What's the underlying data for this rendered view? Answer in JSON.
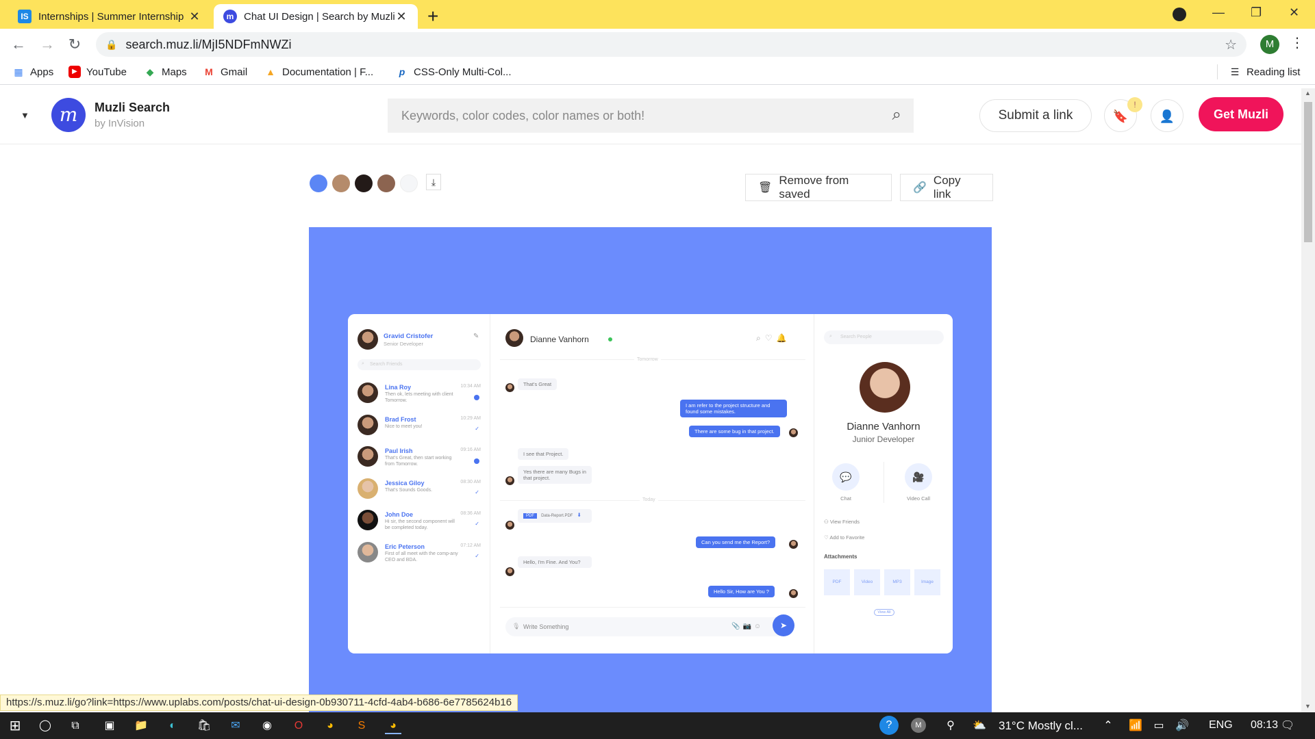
{
  "browser": {
    "tabs": [
      {
        "title": "Internships | Summer Internship",
        "favicon_text": "IS",
        "active": false
      },
      {
        "title": "Chat UI Design | Search by Muzli",
        "favicon_text": "m",
        "active": true
      }
    ],
    "url": "search.muz.li/MjI5NDFmNWZi",
    "profile_initial": "M",
    "bookmarks": [
      {
        "label": "Apps",
        "icon": "apps-grid-icon"
      },
      {
        "label": "YouTube",
        "icon": "youtube-icon"
      },
      {
        "label": "Maps",
        "icon": "maps-icon"
      },
      {
        "label": "Gmail",
        "icon": "gmail-icon"
      },
      {
        "label": "Documentation  |  F...",
        "icon": "firebase-icon"
      },
      {
        "label": "CSS-Only Multi-Col...",
        "icon": "bookmark-site-icon"
      }
    ],
    "reading_list": "Reading list"
  },
  "header": {
    "brand": "Muzli Search",
    "brand_sub": "by InVision",
    "search_placeholder": "Keywords, color codes, color names or both!",
    "submit_link": "Submit a link",
    "badge": "!",
    "get_muzli": "Get Muzli"
  },
  "palette": {
    "colors": [
      "#5b86f5",
      "#b58b6b",
      "#231a18",
      "#8c6450",
      "#f5f6f8"
    ]
  },
  "actions": {
    "remove": "Remove from saved",
    "copy": "Copy link"
  },
  "mockup": {
    "profile_name": "Gravid Cristofer",
    "profile_role": "Senior Developer",
    "search_friends": "Search Friends",
    "friends": [
      {
        "name": "Lina Roy",
        "msg": "Then ok, lets meeting with client Tomorrow.",
        "time": "10:34 AM",
        "unread": true
      },
      {
        "name": "Brad Frost",
        "msg": "Nice to meet you!",
        "time": "10:29 AM",
        "unread": false
      },
      {
        "name": "Paul Irish",
        "msg": "That's Great, then start working from Tomorrow.",
        "time": "09:16 AM",
        "unread": true
      },
      {
        "name": "Jessica Giloy",
        "msg": "That's Sounds Goods.",
        "time": "08:30 AM",
        "unread": false
      },
      {
        "name": "John Doe",
        "msg": "Hi sir, the second component will be completed today.",
        "time": "08:36 AM",
        "unread": false
      },
      {
        "name": "Eric Peterson",
        "msg": "First of all meet with the comp-any CEO and BDA.",
        "time": "07:12 AM",
        "unread": false
      }
    ],
    "chat_name": "Dianne Vanhorn",
    "tomorrow": "Tomorrow",
    "today": "Today",
    "messages": {
      "m1": "That's Great",
      "m2": "I am refer to the project structure and found some mistakes.",
      "m3": "There are some bug in that project.",
      "m4": "I see that Project.",
      "m5": "Yes there are many Bugs in that project.",
      "m6_tag": "PDF",
      "m6_file": "Data-Report.PDF",
      "m7": "Can you send me the Report?",
      "m8": "Hello, I'm Fine. And You?",
      "m9": "Hello Sir, How are You ?"
    },
    "input_placeholder": "Write Something",
    "search_people": "Search People",
    "person_name": "Dianne Vanhorn",
    "person_role": "Junior Developer",
    "chat_label": "Chat",
    "video_label": "Video Call",
    "view_friends": "View Friends",
    "add_favorite": "Add to Favorite",
    "attachments": "Attachments",
    "attachment_types": [
      "PDF",
      "Video",
      "MP3",
      "Image"
    ],
    "view_all": "View All"
  },
  "status_link": "https://s.muz.li/go?link=https://www.uplabs.com/posts/chat-ui-design-0b930711-4cfd-4ab4-b686-6e7785624b16",
  "taskbar": {
    "weather": "31°C  Mostly cl...",
    "lang": "ENG",
    "time": "08:13"
  }
}
